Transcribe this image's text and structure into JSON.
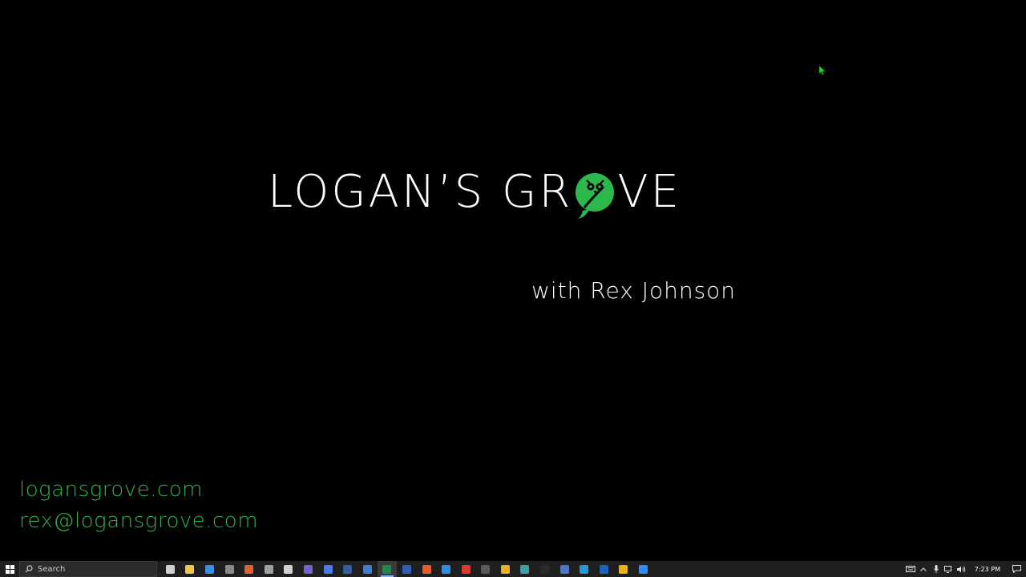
{
  "slide": {
    "logo_part1": "LOGAN’S GR",
    "logo_part2": "VE",
    "tagline": "with Rex Johnson",
    "website": "logansgrove.com",
    "email": "rex@logansgrove.com"
  },
  "colors": {
    "background": "#000000",
    "brand_green": "#2db84d",
    "text": "#ffffff",
    "taskbar": "#1f1f1f"
  },
  "taskbar": {
    "search_placeholder": "Search",
    "apps": [
      {
        "name": "task-view",
        "color": "#cfcfcf"
      },
      {
        "name": "file-explorer",
        "color": "#f2c744"
      },
      {
        "name": "mail",
        "color": "#3a8ee6"
      },
      {
        "name": "calculator",
        "color": "#8a8a8a"
      },
      {
        "name": "app-red-orange",
        "color": "#e06030"
      },
      {
        "name": "app-gray",
        "color": "#a0a0a0"
      },
      {
        "name": "settings",
        "color": "#d0d0d0"
      },
      {
        "name": "app-purple",
        "color": "#7a5fd6"
      },
      {
        "name": "media-player",
        "color": "#4d7ae6"
      },
      {
        "name": "app-dark-blue",
        "color": "#355c9c"
      },
      {
        "name": "app-blue",
        "color": "#3b7fd1"
      },
      {
        "name": "excel",
        "color": "#1e8a4a"
      },
      {
        "name": "word",
        "color": "#2b5fb8"
      },
      {
        "name": "brave",
        "color": "#f05a28"
      },
      {
        "name": "app-blue-2",
        "color": "#2d8ee6"
      },
      {
        "name": "app-red",
        "color": "#d93b2b"
      },
      {
        "name": "terminal-app",
        "color": "#5a5a5a"
      },
      {
        "name": "chrome",
        "color": "#e8b41c"
      },
      {
        "name": "app-teal",
        "color": "#3aa0a0"
      },
      {
        "name": "console",
        "color": "#2a2a2a"
      },
      {
        "name": "app-blue-3",
        "color": "#4a78c8"
      },
      {
        "name": "edge",
        "color": "#1f9bd8"
      },
      {
        "name": "outlook",
        "color": "#1b62b8"
      },
      {
        "name": "chrome-2",
        "color": "#e8b41c"
      },
      {
        "name": "zoom",
        "color": "#2d8cff"
      }
    ],
    "tray": [
      "keyboard-icon",
      "chevron-up-icon",
      "microphone-icon",
      "network-icon",
      "volume-icon"
    ],
    "clock": "7:23 PM"
  }
}
